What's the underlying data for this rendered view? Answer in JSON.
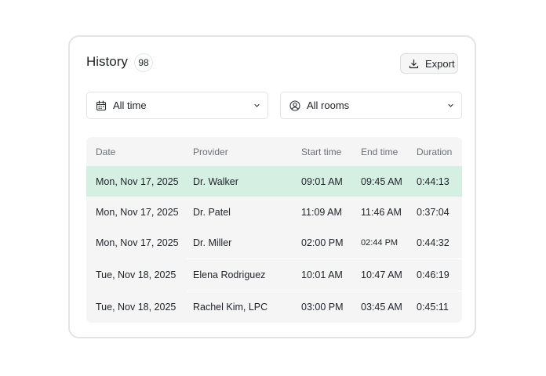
{
  "header": {
    "title": "History",
    "count": "98",
    "export_label": "Export"
  },
  "filters": {
    "time": {
      "value": "All time",
      "icon": "calendar-icon"
    },
    "rooms": {
      "value": "All rooms",
      "icon": "user-circle-icon"
    }
  },
  "table": {
    "columns": [
      "Date",
      "Provider",
      "Start time",
      "End time",
      "Duration"
    ],
    "rows": [
      {
        "date": "Mon, Nov 17, 2025",
        "provider": "Dr. Walker",
        "start": "09:01 AM",
        "end": "09:45 AM",
        "duration": "0:44:13",
        "selected": true
      },
      {
        "date": "Mon, Nov 17, 2025",
        "provider": "Dr. Patel",
        "start": "11:09 AM",
        "end": "11:46 AM",
        "duration": "0:37:04"
      },
      {
        "date": "Mon, Nov 17, 2025",
        "provider": "Dr. Miller",
        "start": "02:00 PM",
        "end": "02:44 PM",
        "duration": "0:44:32"
      },
      {
        "date": "Tue, Nov 18, 2025",
        "provider": "Elena Rodriguez",
        "start": "10:01 AM",
        "end": "10:47 AM",
        "duration": "0:46:19"
      },
      {
        "date": "Tue, Nov 18, 2025",
        "provider": "Rachel Kim, LPC",
        "start": "03:00 PM",
        "end": "03:45 AM",
        "duration": "0:45:11"
      }
    ]
  },
  "colors": {
    "selected_row": "#d5f0e3",
    "table_bg": "#f5f5f6",
    "border": "#e3e4e6"
  }
}
